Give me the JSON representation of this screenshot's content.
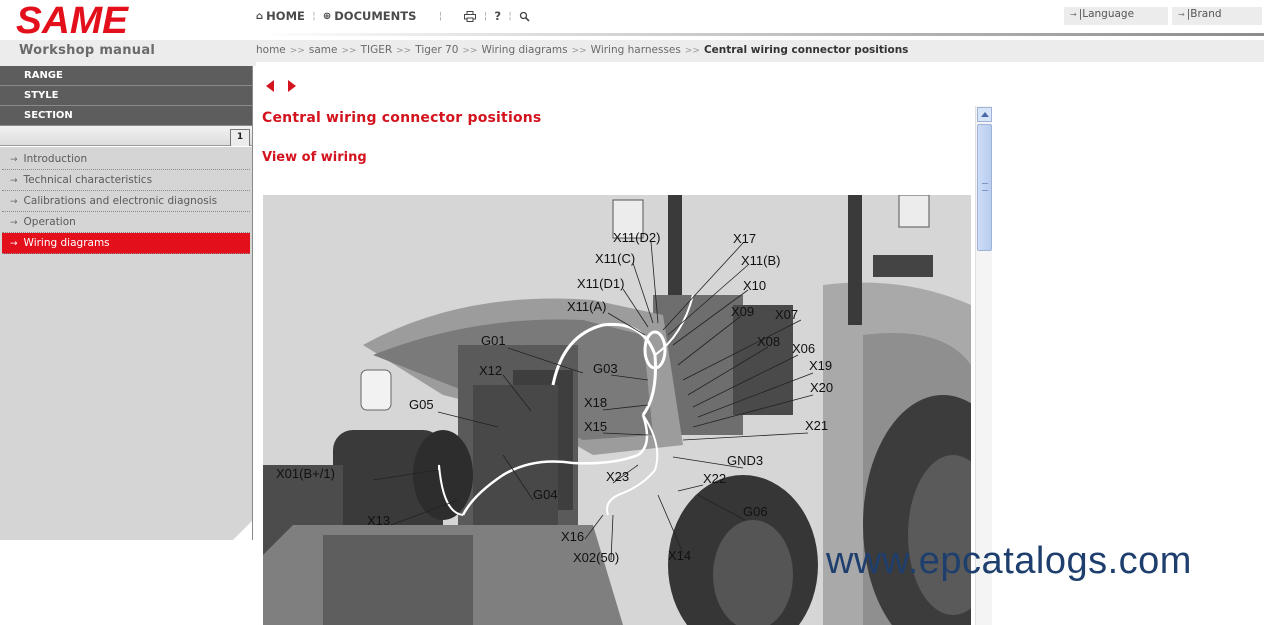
{
  "brand": {
    "logo_text": "SAME",
    "manual_title": "Workshop manual",
    "accent_color": "#e3101b"
  },
  "leftnav": {
    "headers": [
      "RANGE",
      "STYLE",
      "SECTION"
    ],
    "tab_label": "1",
    "items": [
      {
        "label": "Introduction",
        "active": false
      },
      {
        "label": "Technical characteristics",
        "active": false
      },
      {
        "label": "Calibrations and electronic diagnosis",
        "active": false
      },
      {
        "label": "Operation",
        "active": false
      },
      {
        "label": "Wiring diagrams",
        "active": true
      }
    ]
  },
  "topmenu": {
    "home_label": "HOME",
    "documents_label": "DOCUMENTS",
    "print_icon": "print-icon",
    "help_label": "?",
    "search_icon": "search-icon",
    "language_label": "|Language",
    "brand_label": "|Brand"
  },
  "breadcrumb": {
    "items": [
      "home",
      "same",
      "TIGER",
      "Tiger 70",
      "Wiring diagrams",
      "Wiring harnesses"
    ],
    "current": "Central wiring connector positions",
    "separator": ">>"
  },
  "content": {
    "title": "Central wiring connector positions",
    "subtitle": "View of wiring",
    "figure_labels": [
      "X11(D2)",
      "X17",
      "X11(C)",
      "X11(B)",
      "X11(D1)",
      "X10",
      "X11(A)",
      "X09",
      "X07",
      "G01",
      "X08",
      "X06",
      "G03",
      "X19",
      "X12",
      "X20",
      "G05",
      "X18",
      "X15",
      "X21",
      "GND3",
      "X01(B+/1)",
      "X23",
      "X22",
      "G04",
      "G06",
      "X13",
      "X16",
      "X02(50)",
      "X14"
    ],
    "watermark": "www.epcatalogs.com"
  }
}
